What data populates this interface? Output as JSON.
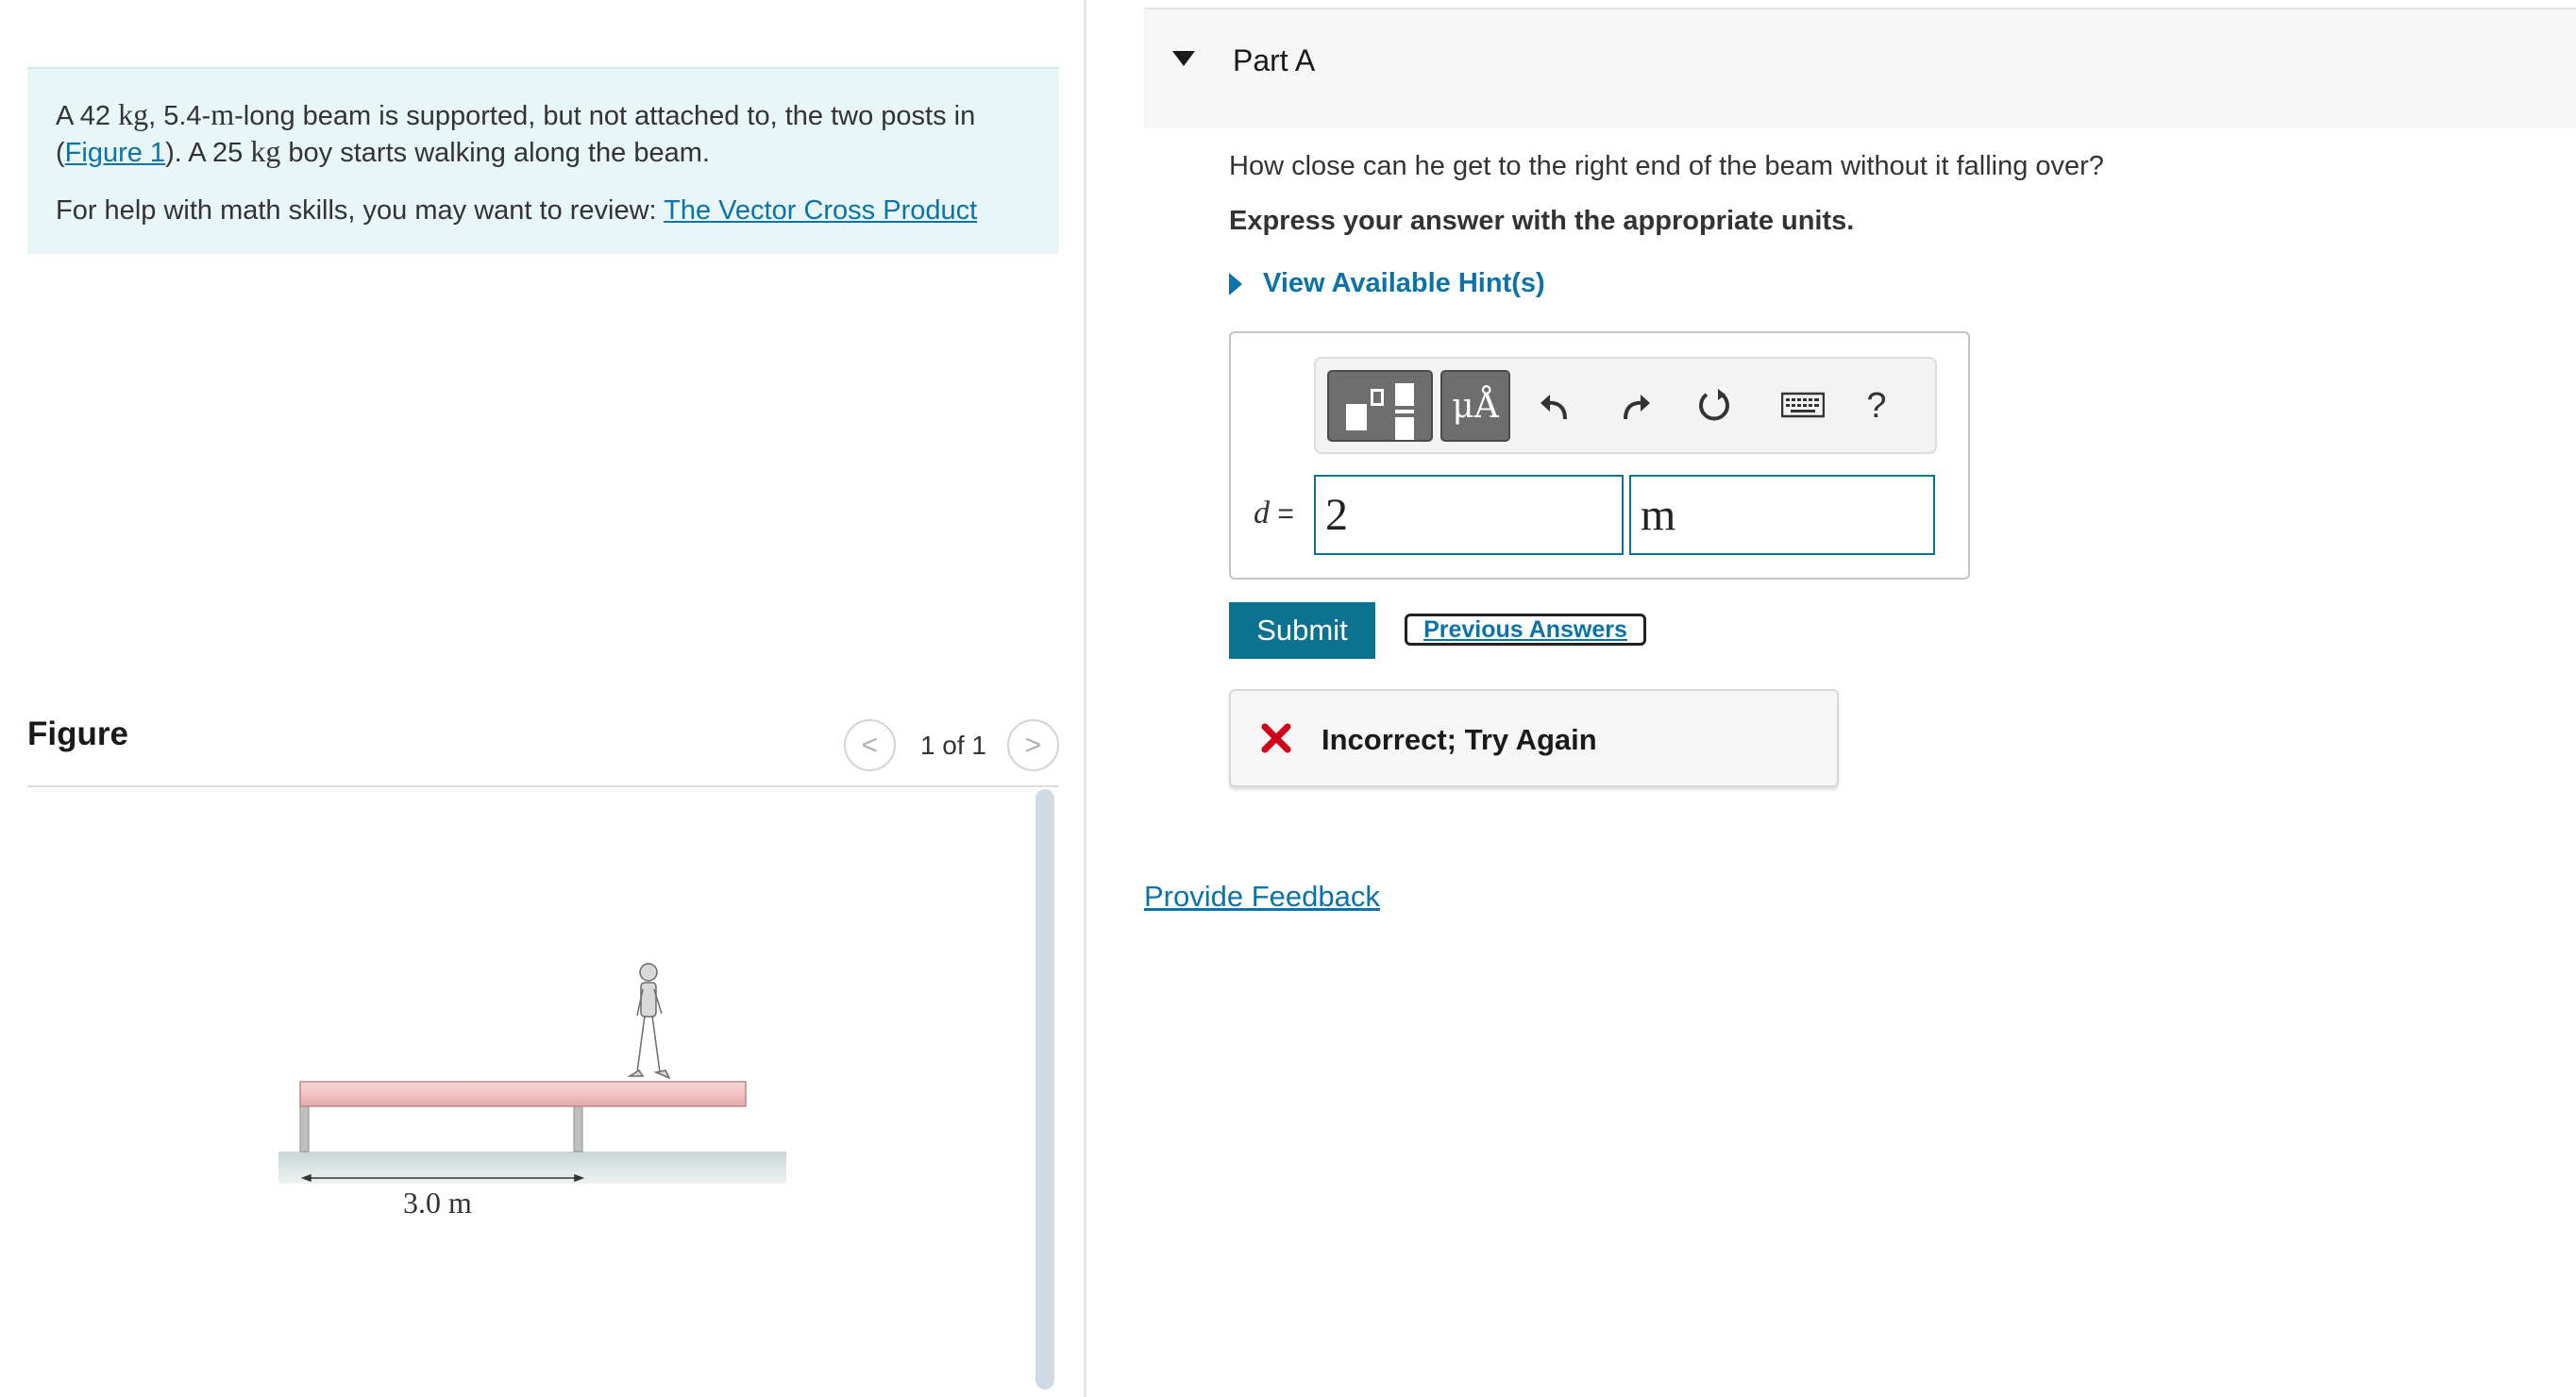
{
  "problem": {
    "text_before_mass": "A 42 ",
    "unit_kg": "kg",
    "text_len": ", 5.4-",
    "unit_m": "m",
    "text_mid": "-long beam is supported, but not attached to, the two posts in (",
    "figure_link": "Figure 1",
    "text_after_link": "). A 25 ",
    "unit_kg2": "kg",
    "text_end": " boy starts walking along the beam.",
    "help_prefix": "For help with math skills, you may want to review: ",
    "help_link": "The Vector Cross Product"
  },
  "figure": {
    "title": "Figure",
    "pager_prev": "<",
    "pager_count": "1 of 1",
    "pager_next": ">",
    "dimension_label": "3.0 m"
  },
  "part": {
    "title": "Part A",
    "question": "How close can he get to the right end of the beam without it falling over?",
    "instruction": "Express your answer with the appropriate units.",
    "hint_label": "View Available Hint(s)"
  },
  "answer": {
    "variable": "d",
    "equals": " =",
    "value": "2",
    "unit": "m",
    "units_button": "μÅ",
    "help_button": "?"
  },
  "actions": {
    "submit": "Submit",
    "previous_answers": "Previous Answers",
    "feedback_text": "Incorrect; Try Again",
    "provide_feedback": "Provide Feedback"
  },
  "colors": {
    "accent": "#0b7290",
    "link": "#0b73a8",
    "error": "#d0021b",
    "problem_bg": "#e8f6f7"
  },
  "icons": [
    "templates-icon",
    "units-icon",
    "undo-icon",
    "redo-icon",
    "reset-icon",
    "keyboard-icon",
    "help-icon",
    "incorrect-x-icon"
  ]
}
